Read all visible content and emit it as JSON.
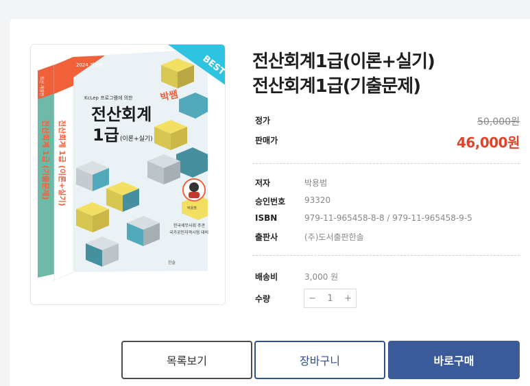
{
  "product": {
    "title_line1": "전산회계1급(이론+실기)",
    "title_line2": "전산회계1급(기출문제)",
    "price_label": "정가",
    "price_value": "50,000원",
    "sale_label": "판매가",
    "sale_value": "46,000원",
    "author_label": "저자",
    "author_value": "박용범",
    "approval_label": "승인번호",
    "approval_value": "93320",
    "isbn_label": "ISBN",
    "isbn_value": "979-11-965458-8-8 / 979-11-965458-9-5",
    "publisher_label": "출판사",
    "publisher_value": "(주)도서출판한솔",
    "shipping_label": "배송비",
    "shipping_value": "3,000 원",
    "qty_label": "수량",
    "qty_value": "1"
  },
  "cover": {
    "badge": "BEST",
    "corner": "2024 개정판",
    "subtitle": "KcLep 프로그램에 의한",
    "title1": "전산회계",
    "title2": "1급",
    "title3": "(이론+실기)",
    "brand": "박쌤",
    "author": "박용범",
    "footer1": "한국세무사회 주관",
    "footer2": "국가공인자격시험 대비",
    "spine1": "전산회계 1급 (이론+실기)",
    "spine2": "전산회계 1급 (기출문제)",
    "spine_tag": "최신 개정판",
    "publisher_mark": "한솔"
  },
  "buttons": {
    "list": "목록보기",
    "cart": "장바구니",
    "buy": "바로구매"
  },
  "colors": {
    "sale": "#e0432b",
    "primary": "#3a5a99",
    "cover_teal": "#4aa6b6",
    "cover_orange": "#f0613a",
    "badge_cyan": "#2ec3e0"
  }
}
